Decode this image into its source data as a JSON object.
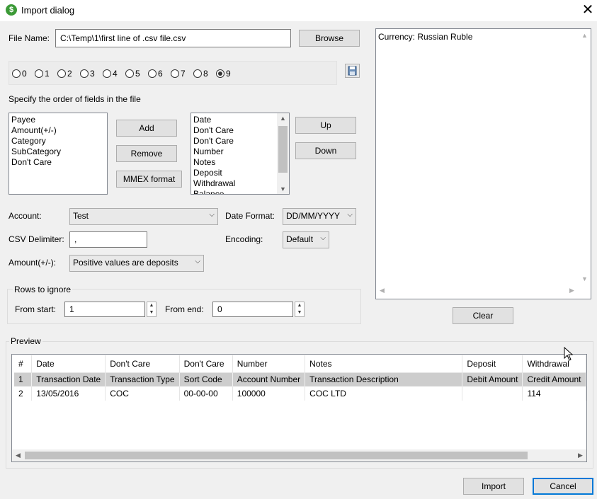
{
  "window": {
    "title": "Import dialog",
    "icon": "dollar-icon"
  },
  "file": {
    "label": "File Name:",
    "value": "C:\\Temp\\1\\first line of .csv file.csv",
    "browse": "Browse"
  },
  "radios": [
    {
      "label": "0",
      "checked": false
    },
    {
      "label": "1",
      "checked": false
    },
    {
      "label": "2",
      "checked": false
    },
    {
      "label": "3",
      "checked": false
    },
    {
      "label": "4",
      "checked": false
    },
    {
      "label": "5",
      "checked": false
    },
    {
      "label": "6",
      "checked": false
    },
    {
      "label": "7",
      "checked": false
    },
    {
      "label": "8",
      "checked": false
    },
    {
      "label": "9",
      "checked": true
    }
  ],
  "fields": {
    "heading": "Specify the order of fields in the file",
    "available": [
      "Payee",
      "Amount(+/-)",
      "Category",
      "SubCategory",
      "Don't Care"
    ],
    "selected": [
      "Date",
      "Don't Care",
      "Don't Care",
      "Number",
      "Notes",
      "Deposit",
      "Withdrawal",
      "Balance"
    ],
    "add": "Add",
    "remove": "Remove",
    "mmex": "MMEX format",
    "up": "Up",
    "down": "Down"
  },
  "account": {
    "label": "Account:",
    "value": "Test"
  },
  "date_format": {
    "label": "Date Format:",
    "value": "DD/MM/YYYY"
  },
  "delimiter": {
    "label": "CSV Delimiter:",
    "value": ","
  },
  "encoding": {
    "label": "Encoding:",
    "value": "Default"
  },
  "amount": {
    "label": "Amount(+/-):",
    "value": "Positive values are deposits"
  },
  "rows_ignore": {
    "title": "Rows to ignore",
    "start_label": "From start:",
    "start_value": "1",
    "end_label": "From end:",
    "end_value": "0"
  },
  "log": {
    "text": "Currency: Russian Ruble",
    "clear": "Clear"
  },
  "preview": {
    "title": "Preview",
    "columns": [
      "#",
      "Date",
      "Don't Care",
      "Don't Care",
      "Number",
      "Notes",
      "Deposit",
      "Withdrawal"
    ],
    "rows": [
      [
        "1",
        "Transaction Date",
        "Transaction Type",
        "Sort Code",
        "Account Number",
        "Transaction Description",
        "Debit Amount",
        "Credit Amount"
      ],
      [
        "2",
        "13/05/2016",
        "COC",
        "00-00-00",
        "100000",
        "COC LTD",
        "",
        "114"
      ]
    ]
  },
  "footer": {
    "import": "Import",
    "cancel": "Cancel"
  }
}
